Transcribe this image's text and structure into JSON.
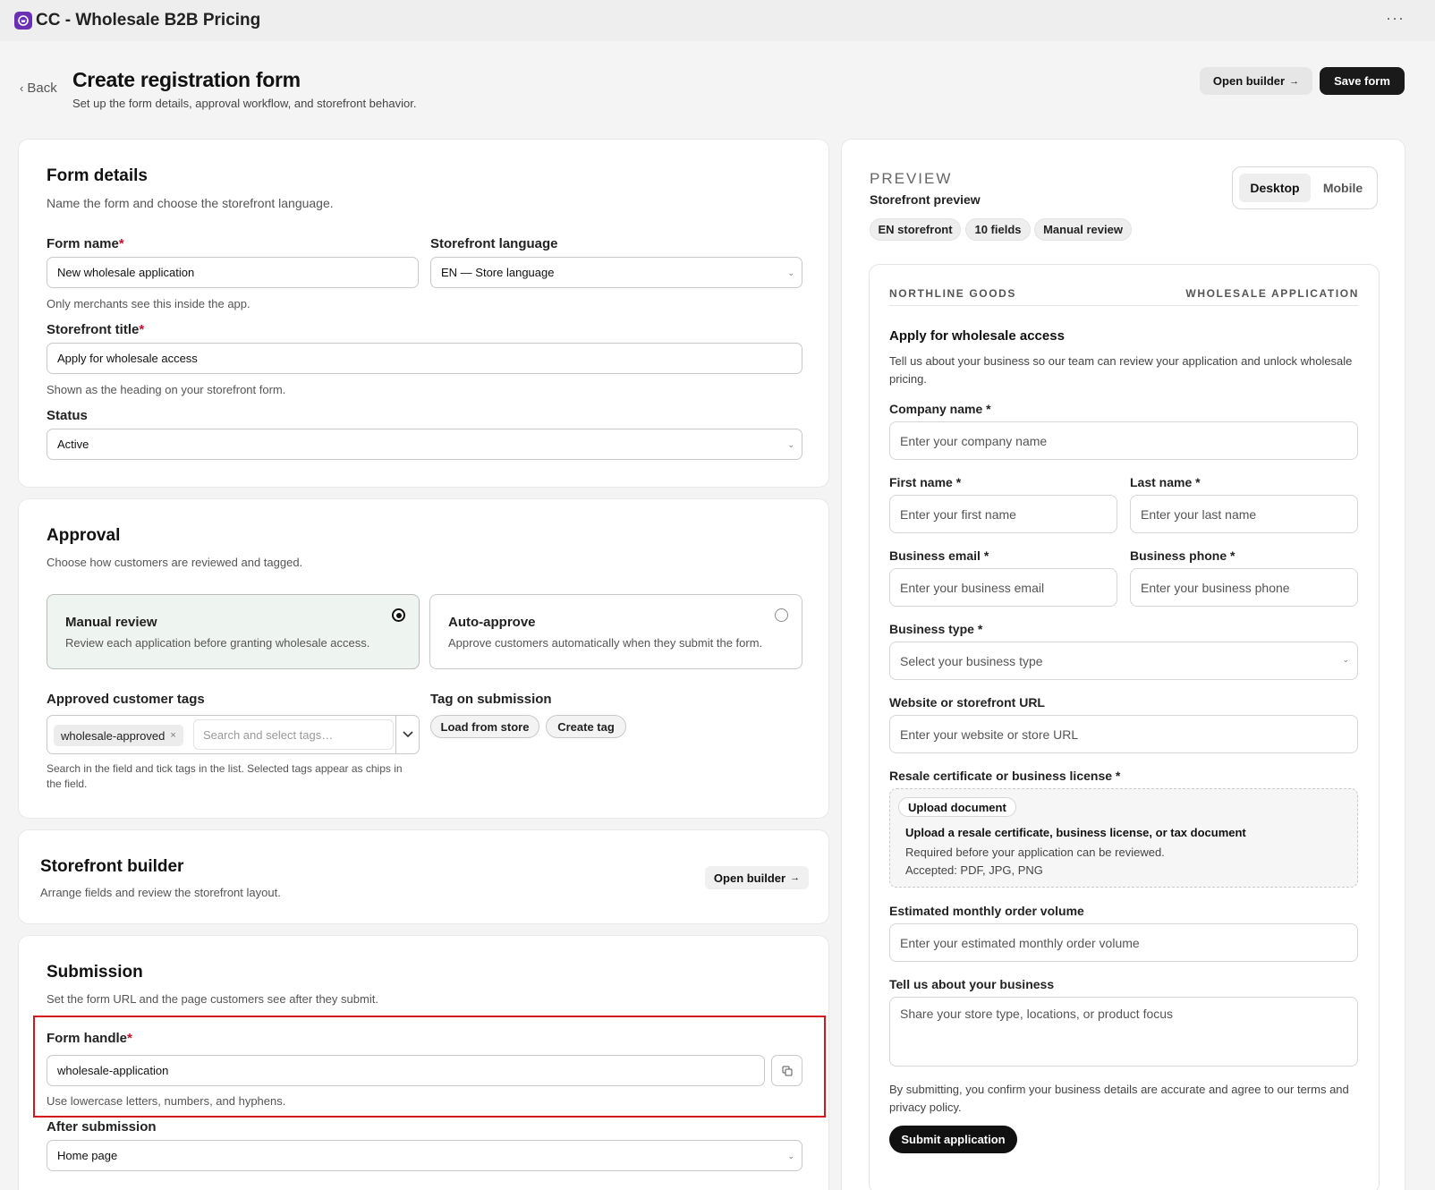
{
  "app": {
    "title": "CC - Wholesale B2B Pricing",
    "more": "···"
  },
  "header": {
    "back": "Back",
    "title": "Create registration form",
    "subtitle": "Set up the form details, approval workflow, and storefront behavior.",
    "open_builder": "Open builder",
    "save": "Save form"
  },
  "form_details": {
    "title": "Form details",
    "desc": "Name the form and choose the storefront language.",
    "form_name_label": "Form name",
    "form_name_value": "New wholesale application",
    "form_name_help": "Only merchants see this inside the app.",
    "language_label": "Storefront language",
    "language_value": "EN — Store language",
    "storefront_title_label": "Storefront title",
    "storefront_title_value": "Apply for wholesale access",
    "storefront_title_help": "Shown as the heading on your storefront form.",
    "status_label": "Status",
    "status_value": "Active",
    "required_mark": "*"
  },
  "approval": {
    "title": "Approval",
    "desc": "Choose how customers are reviewed and tagged.",
    "manual_title": "Manual review",
    "manual_desc": "Review each application before granting wholesale access.",
    "auto_title": "Auto-approve",
    "auto_desc": "Approve customers automatically when they submit the form.",
    "tags_label": "Approved customer tags",
    "tag_chip": "wholesale-approved",
    "tag_chip_remove": "×",
    "tag_search_placeholder": "Search and select tags…",
    "tags_help": "Search in the field and tick tags in the list. Selected tags appear as chips in the field.",
    "tag_on_submission_label": "Tag on submission",
    "load_from_store": "Load from store",
    "create_tag": "Create tag"
  },
  "builder": {
    "title": "Storefront builder",
    "desc": "Arrange fields and review the storefront layout.",
    "open_builder": "Open builder"
  },
  "submission": {
    "title": "Submission",
    "desc": "Set the form URL and the page customers see after they submit.",
    "handle_label": "Form handle",
    "handle_value": "wholesale-application",
    "handle_help": "Use lowercase letters, numbers, and hyphens.",
    "after_label": "After submission",
    "after_value": "Home page"
  },
  "preview": {
    "eyebrow": "PREVIEW",
    "title": "Storefront preview",
    "desktop": "Desktop",
    "mobile": "Mobile",
    "badges": [
      "EN storefront",
      "10 fields",
      "Manual review"
    ],
    "brand": "NORTHLINE GOODS",
    "form_kind": "WHOLESALE APPLICATION",
    "form_title": "Apply for wholesale access",
    "form_desc": "Tell us about your business so our team can review your application and unlock wholesale pricing.",
    "company_label": "Company name",
    "company_ph": "Enter your company name",
    "first_label": "First name",
    "first_ph": "Enter your first name",
    "last_label": "Last name",
    "last_ph": "Enter your last name",
    "email_label": "Business email",
    "email_ph": "Enter your business email",
    "phone_label": "Business phone",
    "phone_ph": "Enter your business phone",
    "type_label": "Business type",
    "type_ph": "Select your business type",
    "website_label": "Website or storefront URL",
    "website_ph": "Enter your website or store URL",
    "resale_label": "Resale certificate or business license",
    "upload_btn": "Upload document",
    "upload_title": "Upload a resale certificate, business license, or tax document",
    "upload_desc1": "Required before your application can be reviewed.",
    "upload_desc2": "Accepted: PDF, JPG, PNG",
    "volume_label": "Estimated monthly order volume",
    "volume_ph": "Enter your estimated monthly order volume",
    "about_label": "Tell us about your business",
    "about_ph": "Share your store type, locations, or product focus",
    "terms": "By submitting, you confirm your business details are accurate and agree to our terms and privacy policy.",
    "submit": "Submit application",
    "required_mark": "*"
  },
  "colors": {
    "accent": "#6b2fb3",
    "highlight": "#d4161d",
    "primary": "#1a1a1a",
    "required": "#c8102e"
  }
}
